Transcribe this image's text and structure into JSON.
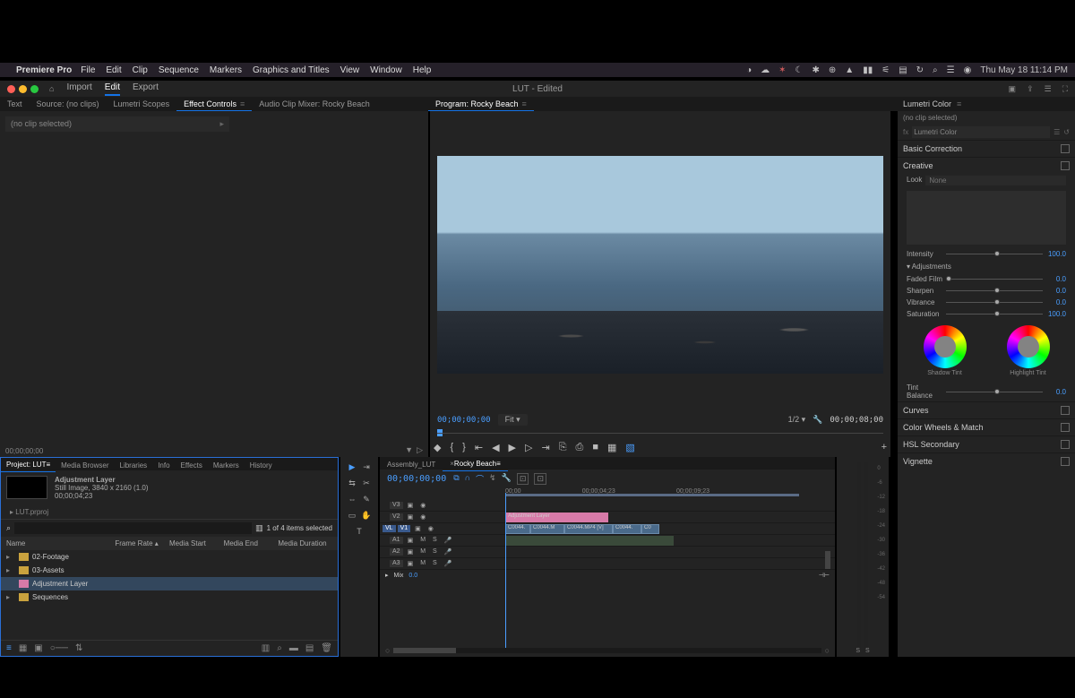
{
  "menubar": {
    "app": "Premiere Pro",
    "items": [
      "File",
      "Edit",
      "Clip",
      "Sequence",
      "Markers",
      "Graphics and Titles",
      "View",
      "Window",
      "Help"
    ],
    "datetime": "Thu May 18  11:14 PM"
  },
  "toprow": {
    "nav": [
      "Import",
      "Edit",
      "Export"
    ],
    "active": "Edit",
    "title": "LUT - Edited"
  },
  "tabs_left": [
    "Text",
    "Source: (no clips)",
    "Lumetri Scopes",
    "Effect Controls",
    "Audio Clip Mixer: Rocky Beach"
  ],
  "tabs_left_active": "Effect Controls",
  "tabs_mid": [
    "Program: Rocky Beach"
  ],
  "effect_controls": {
    "msg": "(no clip selected)"
  },
  "program": {
    "tc_left": "00;00;00;00",
    "fit": "Fit",
    "half": "1/2",
    "tc_right": "00;00;08;00"
  },
  "transport_icons": [
    "◆",
    "{",
    "}",
    "⇤",
    "◀",
    "▶",
    "▷",
    "⇥",
    "⎘",
    "⎙",
    "■",
    "▦",
    "▧"
  ],
  "lumetri": {
    "title": "Lumetri Color",
    "noclip": "(no clip selected)",
    "fxname": "Lumetri Color",
    "sections": [
      "Basic Correction",
      "Creative",
      "Curves",
      "Color Wheels & Match",
      "HSL Secondary",
      "Vignette"
    ],
    "creative": {
      "look_label": "Look",
      "look_value": "None",
      "intensity_label": "Intensity",
      "intensity_value": "100.0",
      "adjustments": "Adjustments",
      "sliders": [
        {
          "label": "Faded Film",
          "value": "0.0"
        },
        {
          "label": "Sharpen",
          "value": "0.0"
        },
        {
          "label": "Vibrance",
          "value": "0.0"
        },
        {
          "label": "Saturation",
          "value": "100.0"
        }
      ],
      "wheel1": "Shadow Tint",
      "wheel2": "Highlight Tint",
      "tint_label": "Tint Balance",
      "tint_value": "0.0"
    }
  },
  "project": {
    "tabs": [
      "Project: LUT",
      "Media Browser",
      "Libraries",
      "Info",
      "Effects",
      "Markers",
      "History"
    ],
    "active": "Project: LUT",
    "item_name": "Adjustment Layer",
    "item_meta": "Still Image, 3840 x 2160 (1.0)",
    "item_dur": "00;00;04;23",
    "filename": "LUT.prproj",
    "selcount": "1 of 4 items selected",
    "columns": [
      "Name",
      "Frame Rate",
      "Media Start",
      "Media End",
      "Media Duration"
    ],
    "rows": [
      {
        "type": "folder",
        "name": "02-Footage"
      },
      {
        "type": "folder",
        "name": "03-Assets"
      },
      {
        "type": "adj",
        "name": "Adjustment Layer",
        "selected": true
      },
      {
        "type": "folder",
        "name": "Sequences"
      }
    ]
  },
  "timeline": {
    "tabs": [
      "Assembly_LUT",
      "Rocky Beach"
    ],
    "active": "Rocky Beach",
    "tc": "00;00;00;00",
    "ruler": [
      "00;00",
      "00;00;04;23",
      "00;00;09;23"
    ],
    "tracks": {
      "v3": "V3",
      "v2": "V2",
      "v1": "V1",
      "a1": "A1",
      "a2": "A2",
      "a3": "A3",
      "mix": "Mix"
    },
    "adj_clip": "Adjustment Layer",
    "vclips": [
      "C0044.",
      "C0044.M",
      "C0044.MP4 [V]",
      "C0044.",
      "C0"
    ],
    "mix_val": "0.0"
  },
  "meter_marks": [
    "0",
    "-6",
    "-12",
    "-18",
    "-24",
    "-30",
    "-36",
    "-42",
    "-48",
    "-54"
  ]
}
